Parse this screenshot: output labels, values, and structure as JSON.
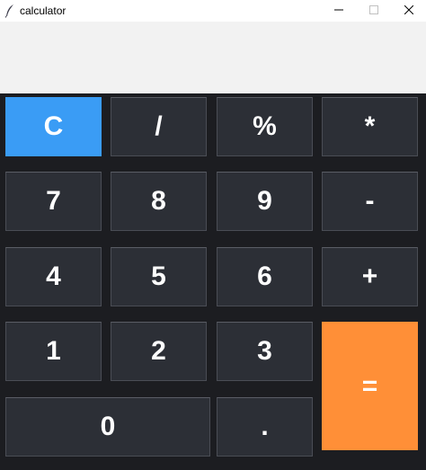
{
  "window": {
    "title": "calculator",
    "icon": "feather-icon"
  },
  "display": {
    "value": ""
  },
  "keys": {
    "clear": "C",
    "divide": "/",
    "percent": "%",
    "multiply": "*",
    "seven": "7",
    "eight": "8",
    "nine": "9",
    "minus": "-",
    "four": "4",
    "five": "5",
    "six": "6",
    "plus": "+",
    "one": "1",
    "two": "2",
    "three": "3",
    "equals": "=",
    "zero": "0",
    "decimal": "."
  },
  "colors": {
    "keypad_background": "#1c1d21",
    "key_background": "#2c2f36",
    "clear_key": "#3a9cf5",
    "equals_key": "#ff8f37",
    "display_background": "#f2f2f2"
  }
}
